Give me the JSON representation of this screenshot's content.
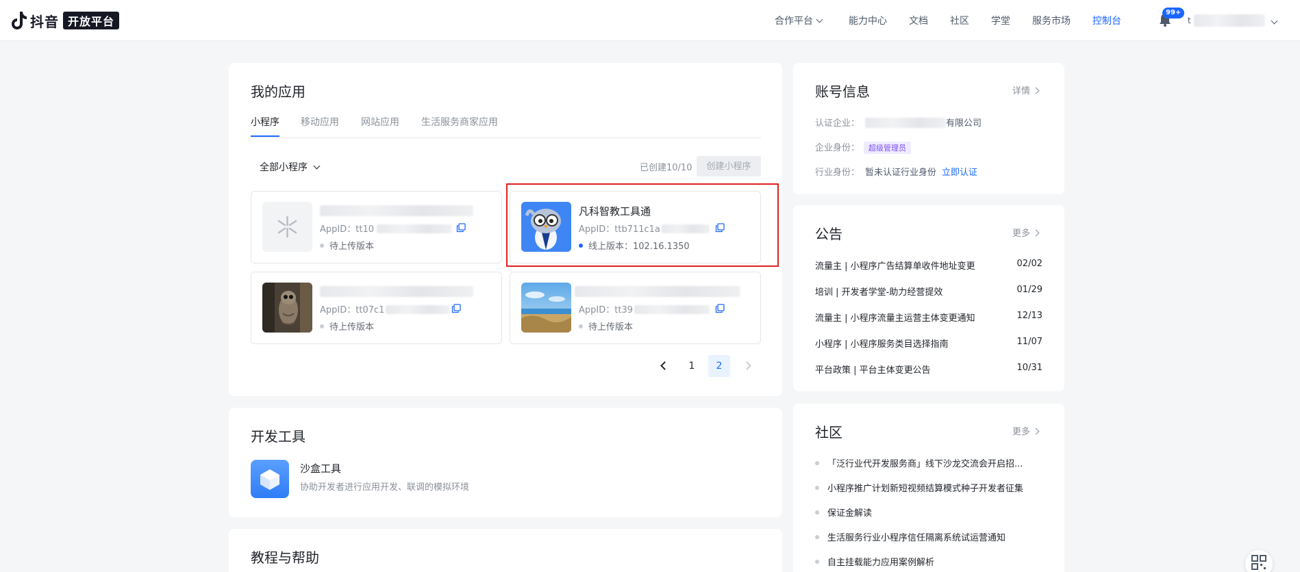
{
  "logo": {
    "text": "抖音",
    "box": "开放平台"
  },
  "nav": {
    "items": [
      {
        "label": "合作平台",
        "has_dropdown": true,
        "active": false
      },
      {
        "label": "能力中心",
        "active": false
      },
      {
        "label": "文档",
        "active": false
      },
      {
        "label": "社区",
        "active": false
      },
      {
        "label": "学堂",
        "active": false
      },
      {
        "label": "服务市场",
        "active": false
      },
      {
        "label": "控制台",
        "active": true
      }
    ],
    "notification_badge": "99+",
    "user_initial": "t"
  },
  "my_apps": {
    "title": "我的应用",
    "tabs": [
      "小程序",
      "移动应用",
      "网站应用",
      "生活服务商家应用"
    ],
    "active_tab": 0,
    "filter": "全部小程序",
    "created": "已创建10/10",
    "create_button": "创建小程序",
    "apps": [
      {
        "name": "",
        "appid_label": "AppID：",
        "appid": "tt10",
        "status": "待上传版本",
        "online": false,
        "icon": "placeholder-icon"
      },
      {
        "name": "凡科智教工具通",
        "appid_label": "AppID：",
        "appid": "ttb711c1a",
        "status": "线上版本：102.16.1350",
        "online": true,
        "icon": "owl-mascot-icon"
      },
      {
        "name": "",
        "appid_label": "AppID：",
        "appid": "tt07c1",
        "status": "待上传版本",
        "online": false,
        "icon": "owl-photo-icon"
      },
      {
        "name": "",
        "appid_label": "AppID：",
        "appid": "tt39",
        "status": "待上传版本",
        "online": false,
        "icon": "beach-photo-icon"
      }
    ],
    "pagination": {
      "pages": [
        "1",
        "2"
      ],
      "current": "2"
    }
  },
  "dev_tools": {
    "title": "开发工具",
    "tool_name": "沙盒工具",
    "tool_desc": "协助开发者进行应用开发、联调的模拟环境"
  },
  "help": {
    "title": "教程与帮助"
  },
  "account": {
    "title": "账号信息",
    "detail": "详情",
    "company_label": "认证企业：",
    "company_suffix": "有限公司",
    "role_label": "企业身份：",
    "role_tag": "超级管理员",
    "industry_label": "行业身份：",
    "industry_value": "暂未认证行业身份",
    "industry_link": "立即认证"
  },
  "announcements": {
    "title": "公告",
    "more": "更多",
    "items": [
      {
        "text": "流量主 | 小程序广告结算单收件地址变更",
        "date": "02/02"
      },
      {
        "text": "培训 | 开发者学堂-助力经营提效",
        "date": "01/29"
      },
      {
        "text": "流量主 | 小程序流量主运营主体变更通知",
        "date": "12/13"
      },
      {
        "text": "小程序 | 小程序服务类目选择指南",
        "date": "11/07"
      },
      {
        "text": "平台政策 | 平台主体变更公告",
        "date": "10/31"
      }
    ]
  },
  "community": {
    "title": "社区",
    "more": "更多",
    "items": [
      "「泛行业代开发服务商」线下沙龙交流会开启招...",
      "小程序推广计划新短视频结算模式种子开发者征集",
      "保证金解读",
      "生活服务行业小程序信任隔离系统试运营通知",
      "自主挂载能力应用案例解析"
    ]
  },
  "colors": {
    "accent": "#1966ff",
    "highlight": "#e02020",
    "background": "#f5f6f7"
  }
}
